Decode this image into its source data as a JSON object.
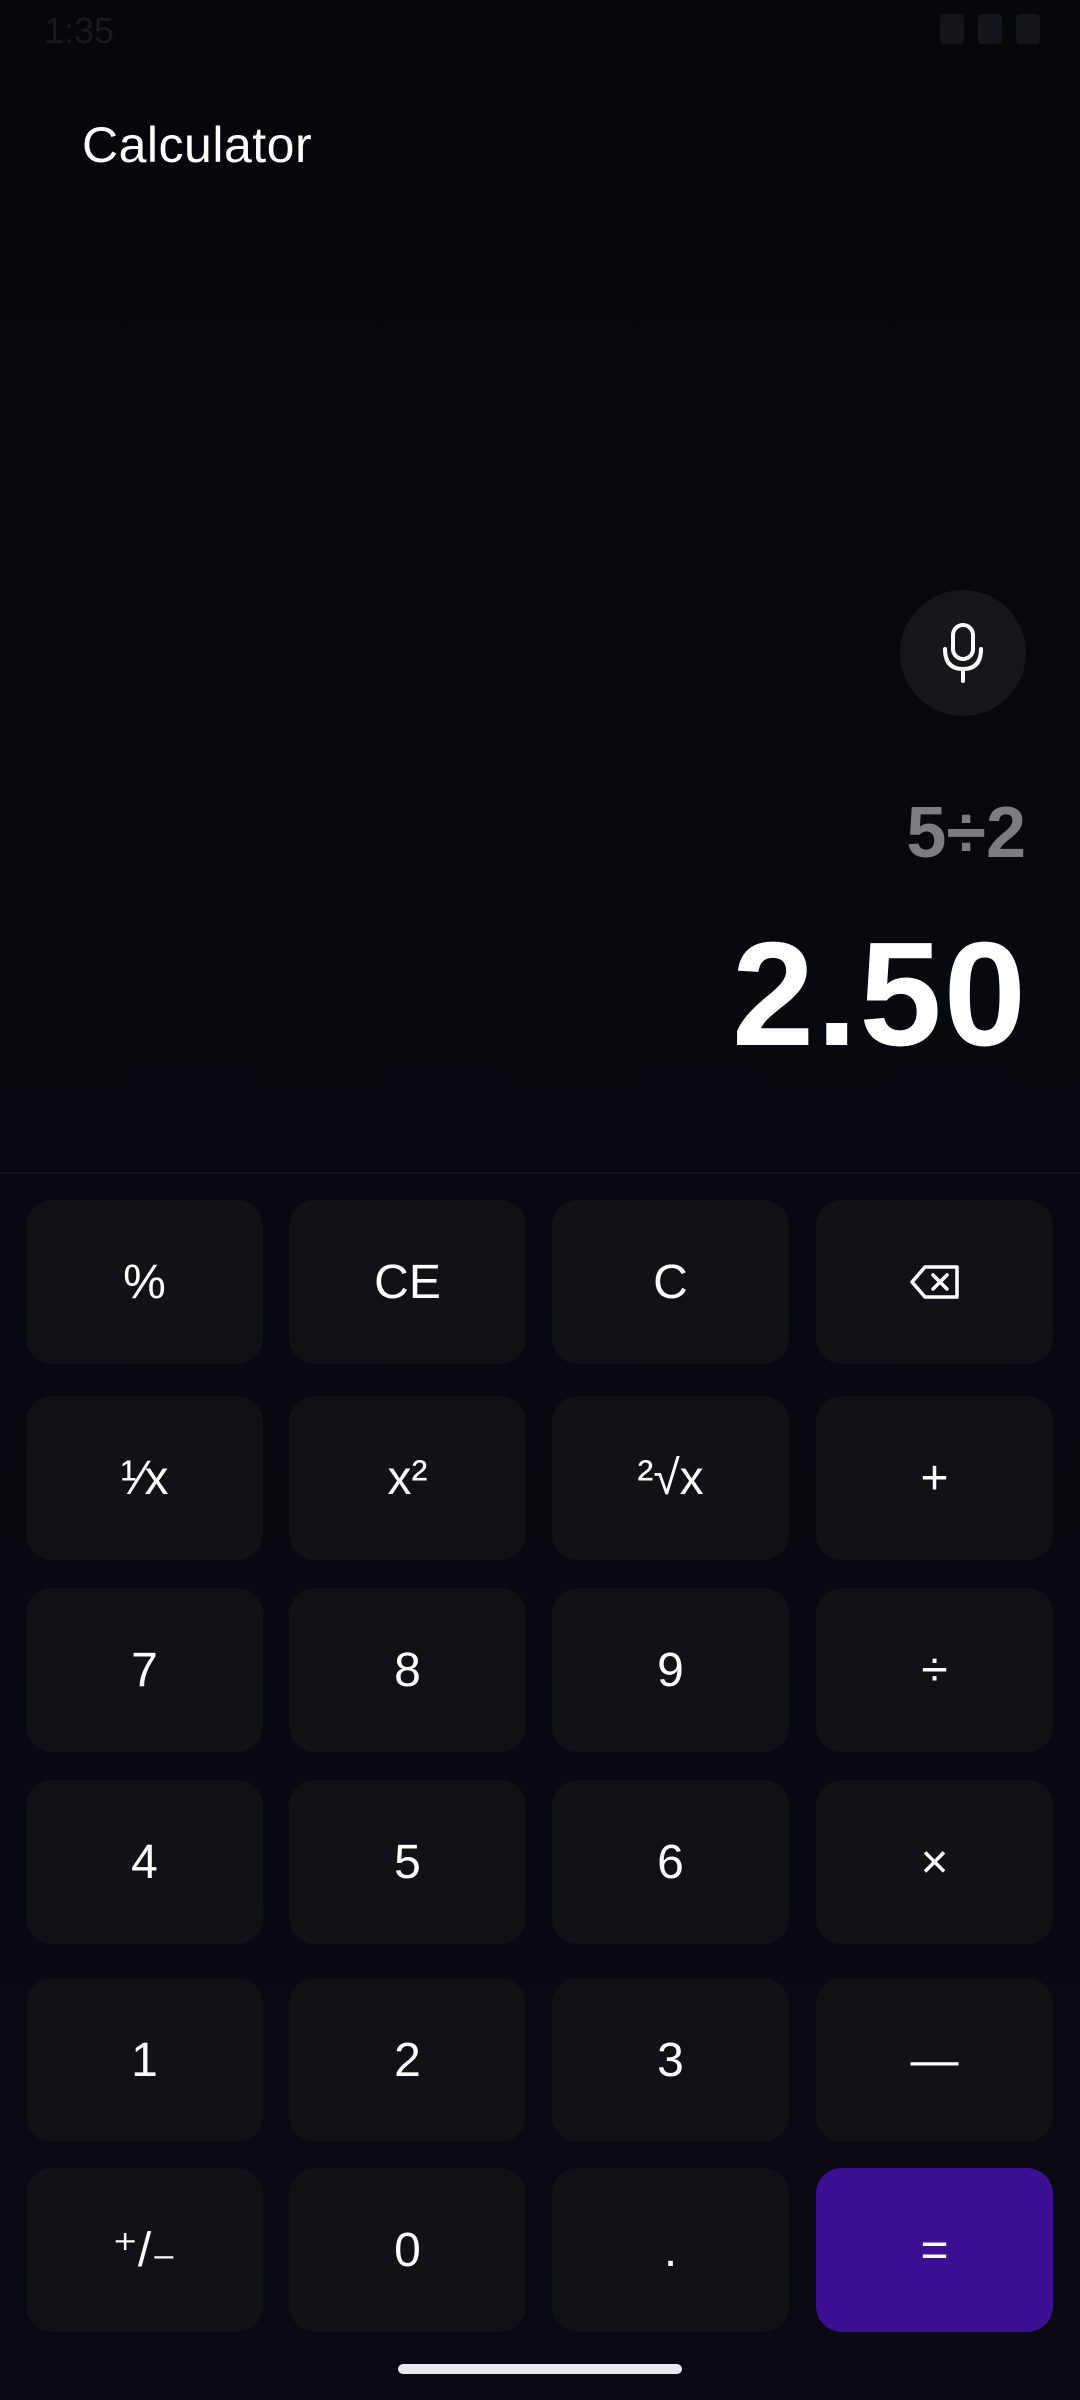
{
  "status_bar": {
    "time": "1:35"
  },
  "app": {
    "title": "Calculator"
  },
  "display": {
    "expression": "5÷2",
    "result": "2.50"
  },
  "keypad": {
    "rows": [
      [
        "%",
        "CE",
        "C",
        "⌫"
      ],
      [
        "¹⁄x",
        "x²",
        "²√x",
        "+"
      ],
      [
        "7",
        "8",
        "9",
        "÷"
      ],
      [
        "4",
        "5",
        "6",
        "×"
      ],
      [
        "1",
        "2",
        "3",
        "—"
      ],
      [
        "⁺/₋",
        "0",
        ".",
        "="
      ]
    ]
  },
  "icons": {
    "mic": "microphone-icon",
    "backspace": "backspace-icon"
  },
  "colors": {
    "background": "#07070d",
    "key": "#111118",
    "equals_key": "#3d0f93",
    "expression_text": "#7c7c82"
  }
}
